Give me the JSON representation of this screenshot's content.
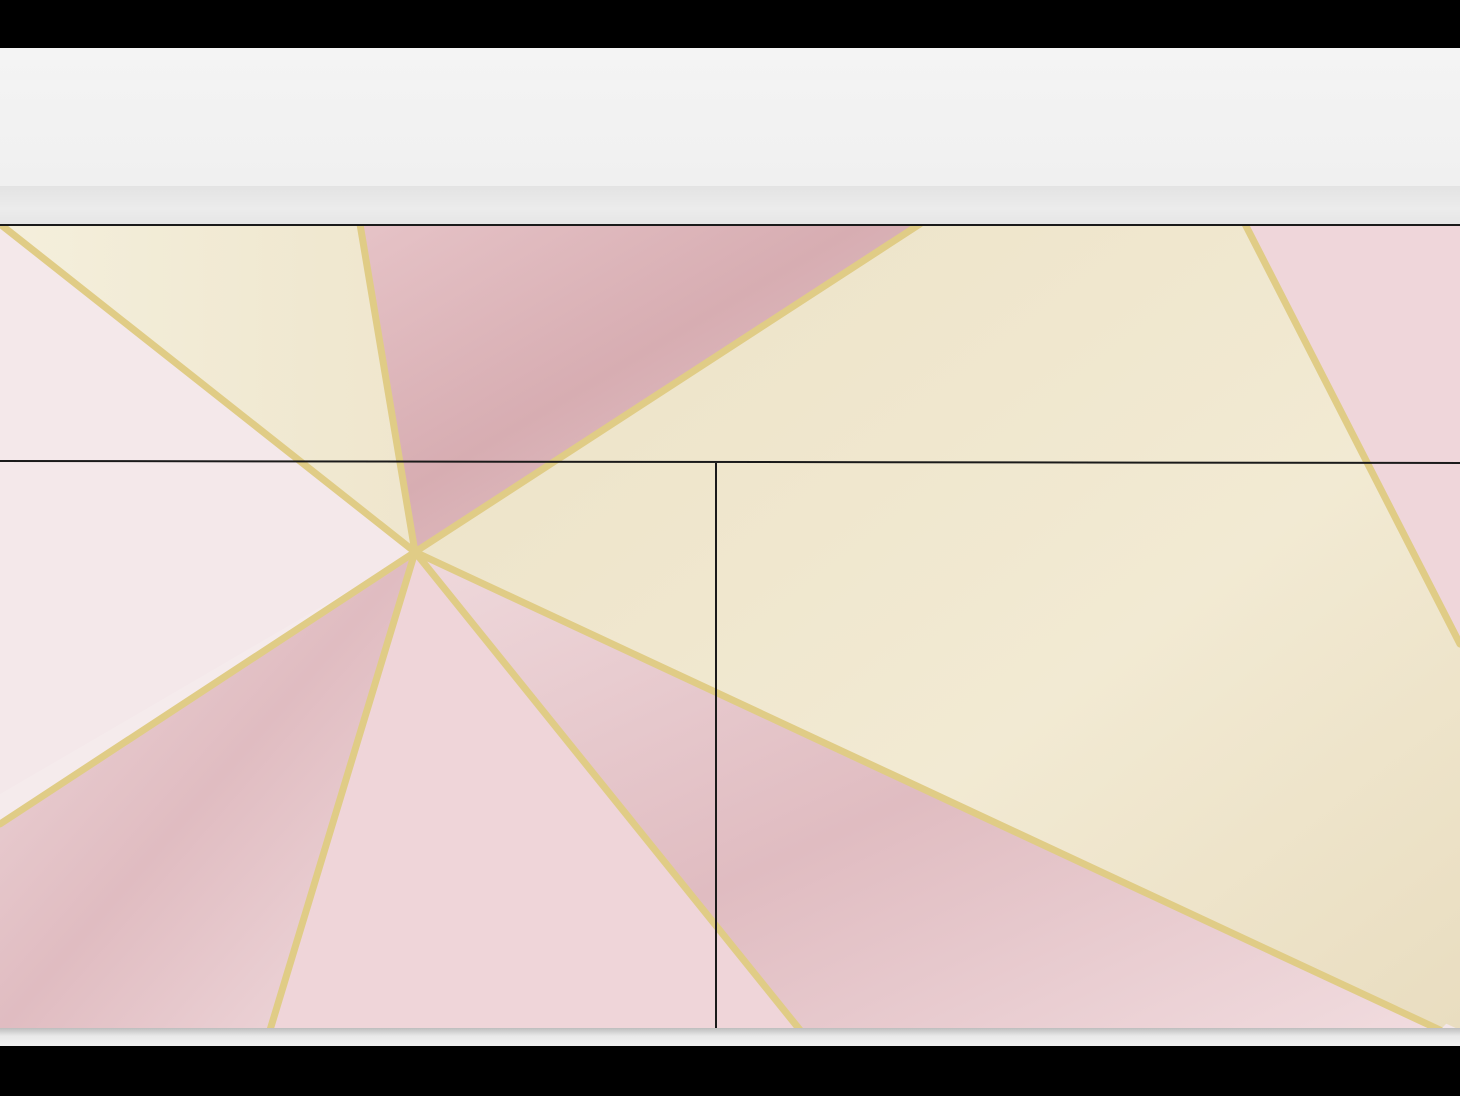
{
  "scene": {
    "subject": "sideboard-front-geometric-decor",
    "colors": {
      "blush": "#f3e6e8",
      "rose": "#ecd3d7",
      "rose_foil": "#d9b2b6",
      "champagne": "#efe7d0",
      "cream": "#f3eedc",
      "gold_line": "#e2cf8a",
      "countertop": "#f2f2f2",
      "frame": "#000000",
      "panel_gap": "#1a1a1a"
    },
    "panels": {
      "count": 3,
      "layout": "one-wide-drawer-over-two-doors"
    }
  }
}
